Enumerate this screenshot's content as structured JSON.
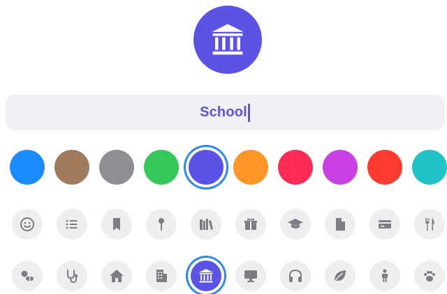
{
  "list_name": {
    "value": "School"
  },
  "preview": {
    "icon": "building-columns-icon",
    "color": "#5b53e6"
  },
  "colors": [
    {
      "name": "blue",
      "hex": "#1a8cff",
      "selected": false
    },
    {
      "name": "brown",
      "hex": "#a27b5c",
      "selected": false
    },
    {
      "name": "gray",
      "hex": "#8e8e93",
      "selected": false
    },
    {
      "name": "green",
      "hex": "#35c759",
      "selected": false
    },
    {
      "name": "indigo",
      "hex": "#5b53e6",
      "selected": true
    },
    {
      "name": "orange",
      "hex": "#ff9526",
      "selected": false
    },
    {
      "name": "pink",
      "hex": "#ff2d55",
      "selected": false
    },
    {
      "name": "purple",
      "hex": "#c841e5",
      "selected": false
    },
    {
      "name": "red",
      "hex": "#ff3b30",
      "selected": false
    },
    {
      "name": "teal",
      "hex": "#22c3c7",
      "selected": false
    }
  ],
  "icons_row1": [
    {
      "name": "smiley-icon",
      "selected": false
    },
    {
      "name": "list-icon",
      "selected": false
    },
    {
      "name": "bookmark-icon",
      "selected": false
    },
    {
      "name": "pushpin-icon",
      "selected": false
    },
    {
      "name": "books-icon",
      "selected": false
    },
    {
      "name": "gift-icon",
      "selected": false
    },
    {
      "name": "graduation-cap-icon",
      "selected": false
    },
    {
      "name": "document-icon",
      "selected": false
    },
    {
      "name": "credit-card-icon",
      "selected": false
    },
    {
      "name": "fork-knife-icon",
      "selected": false
    }
  ],
  "icons_row2": [
    {
      "name": "pills-icon",
      "selected": false
    },
    {
      "name": "stethoscope-icon",
      "selected": false
    },
    {
      "name": "house-icon",
      "selected": false
    },
    {
      "name": "office-building-icon",
      "selected": false
    },
    {
      "name": "building-columns-icon",
      "selected": true
    },
    {
      "name": "monitor-icon",
      "selected": false
    },
    {
      "name": "headphones-icon",
      "selected": false
    },
    {
      "name": "leaf-icon",
      "selected": false
    },
    {
      "name": "person-icon",
      "selected": false
    },
    {
      "name": "paw-icon",
      "selected": false
    }
  ]
}
